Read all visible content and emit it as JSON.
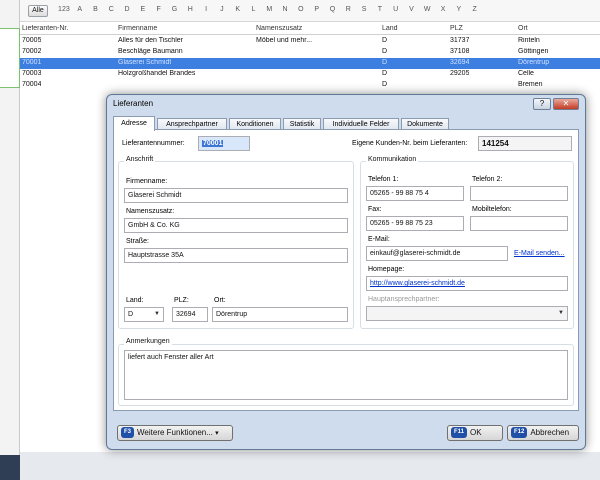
{
  "background": {
    "alpha_bar": {
      "all_label": "Alle",
      "letters": [
        "123",
        "A",
        "B",
        "C",
        "D",
        "E",
        "F",
        "G",
        "H",
        "I",
        "J",
        "K",
        "L",
        "M",
        "N",
        "O",
        "P",
        "Q",
        "R",
        "S",
        "T",
        "U",
        "V",
        "W",
        "X",
        "Y",
        "Z"
      ]
    },
    "grid": {
      "columns": [
        "Lieferanten-Nr.",
        "Firmenname",
        "Namenszusatz",
        "Land",
        "PLZ",
        "Ort"
      ],
      "rows": [
        [
          "70005",
          "Alles für den Tischler",
          "Möbel und mehr...",
          "D",
          "31737",
          "Rinteln"
        ],
        [
          "70002",
          "Beschläge Baumann",
          "",
          "D",
          "37108",
          "Göttingen"
        ],
        [
          "70001",
          "Glaserei Schmidt",
          "",
          "D",
          "32694",
          "Dörentrup"
        ],
        [
          "70003",
          "Holzgroßhandel Brandes",
          "",
          "D",
          "29205",
          "Celle"
        ],
        [
          "70004",
          "",
          "",
          "D",
          "",
          "Bremen"
        ]
      ],
      "selected_index": 2
    }
  },
  "dialog": {
    "title": "Lieferanten",
    "help_glyph": "?",
    "close_glyph": "✕",
    "tabs": [
      "Adresse",
      "Ansprechpartner",
      "Konditionen",
      "Statistik",
      "Individuelle Felder",
      "Dokumente"
    ],
    "active_tab": 0,
    "supplier_number_label": "Lieferantennummer:",
    "supplier_number": "70001",
    "own_customer_label": "Eigene Kunden-Nr. beim Lieferanten:",
    "own_customer_number": "141254",
    "anschrift": {
      "title": "Anschrift",
      "company_label": "Firmenname:",
      "company": "Glaserei Schmidt",
      "suffix_label": "Namenszusatz:",
      "suffix": "GmbH & Co. KG",
      "street_label": "Straße:",
      "street": "Hauptstrasse 35A",
      "country_label": "Land:",
      "country": "D",
      "zip_label": "PLZ:",
      "zip": "32694",
      "city_label": "Ort:",
      "city": "Dörentrup"
    },
    "kommunikation": {
      "title": "Kommunikation",
      "phone1_label": "Telefon 1:",
      "phone1": "05265 - 99 88 75 4",
      "phone2_label": "Telefon 2:",
      "phone2": "",
      "fax_label": "Fax:",
      "fax": "05265 - 99 88 75 23",
      "mobile_label": "Mobiltelefon:",
      "mobile": "",
      "email_label": "E-Mail:",
      "email": "einkauf@glaserei-schmidt.de",
      "email_send": "E-Mail senden...",
      "homepage_label": "Homepage:",
      "homepage": "http://www.glaserei-schmidt.de",
      "contact_label": "Hauptansprechpartner:",
      "contact": ""
    },
    "notes": {
      "title": "Anmerkungen",
      "text": "liefert auch Fenster aller Art"
    },
    "footer": {
      "more_key": "F3",
      "more_label": "Weitere Funktionen...",
      "more_arrow": "▾",
      "ok_key": "F11",
      "ok_label": "OK",
      "cancel_key": "F12",
      "cancel_label": "Abbrechen"
    }
  }
}
